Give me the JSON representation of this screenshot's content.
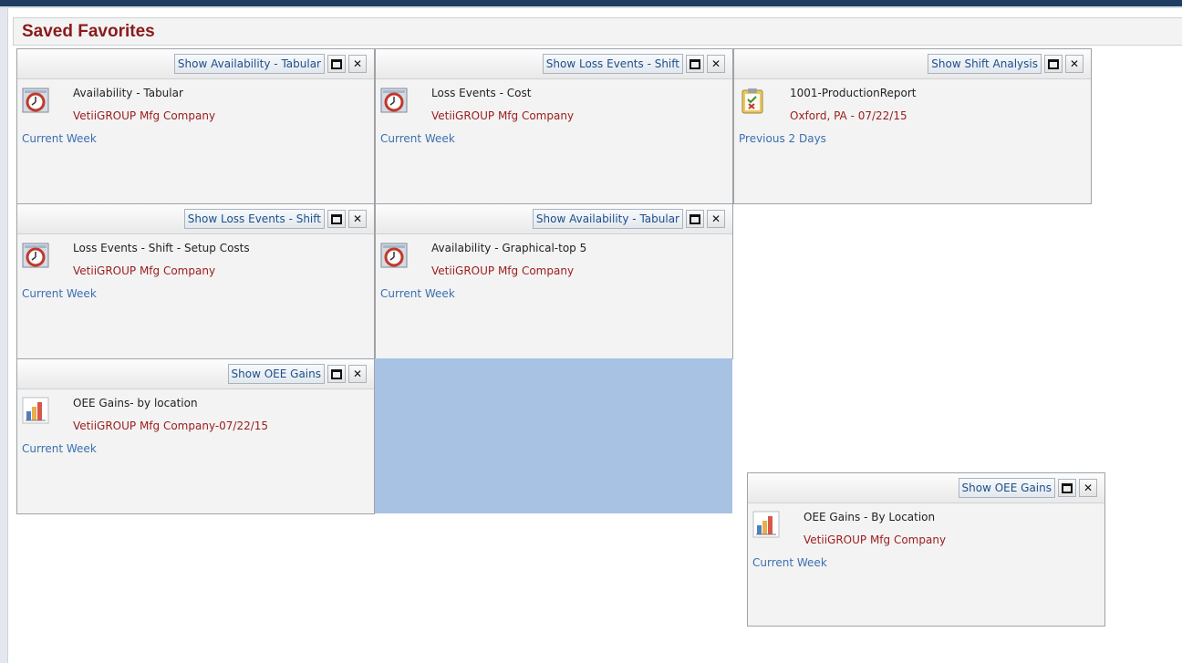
{
  "page": {
    "title": "Saved Favorites"
  },
  "favorites": [
    {
      "show_label": "Show Availability - Tabular",
      "title": "Availability - Tabular",
      "subtitle": "VetiiGROUP Mfg Company",
      "period": "Current Week",
      "icon": "clock-report-icon"
    },
    {
      "show_label": "Show Loss Events - Shift",
      "title": "Loss Events - Cost",
      "subtitle": "VetiiGROUP Mfg Company",
      "period": "Current Week",
      "icon": "clock-report-icon"
    },
    {
      "show_label": "Show Shift Analysis",
      "title": "1001-ProductionReport",
      "subtitle": "Oxford, PA - 07/22/15",
      "period": "Previous 2 Days",
      "icon": "clipboard-report-icon"
    },
    {
      "show_label": "Show Loss Events - Shift",
      "title": "Loss Events - Shift - Setup Costs",
      "subtitle": "VetiiGROUP Mfg Company",
      "period": "Current Week",
      "icon": "clock-report-icon"
    },
    {
      "show_label": "Show Availability - Tabular",
      "title": "Availability - Graphical-top 5",
      "subtitle": "VetiiGROUP Mfg Company",
      "period": "Current Week",
      "icon": "clock-report-icon"
    },
    {
      "show_label": "Show OEE Gains",
      "title": "OEE Gains- by location",
      "subtitle": "VetiiGROUP Mfg Company-07/22/15",
      "period": "Current Week",
      "icon": "bar-chart-icon"
    },
    {
      "show_label": "Show OEE Gains",
      "title": "OEE Gains - By Location",
      "subtitle": "VetiiGROUP Mfg Company",
      "period": "Current Week",
      "icon": "bar-chart-icon"
    }
  ],
  "colors": {
    "title": "#8b1a1a",
    "subtitle": "#9b1c1c",
    "period_link": "#3a6fb0",
    "button_text": "#1d4f8c",
    "drop_zone": "#a8c2e3"
  }
}
